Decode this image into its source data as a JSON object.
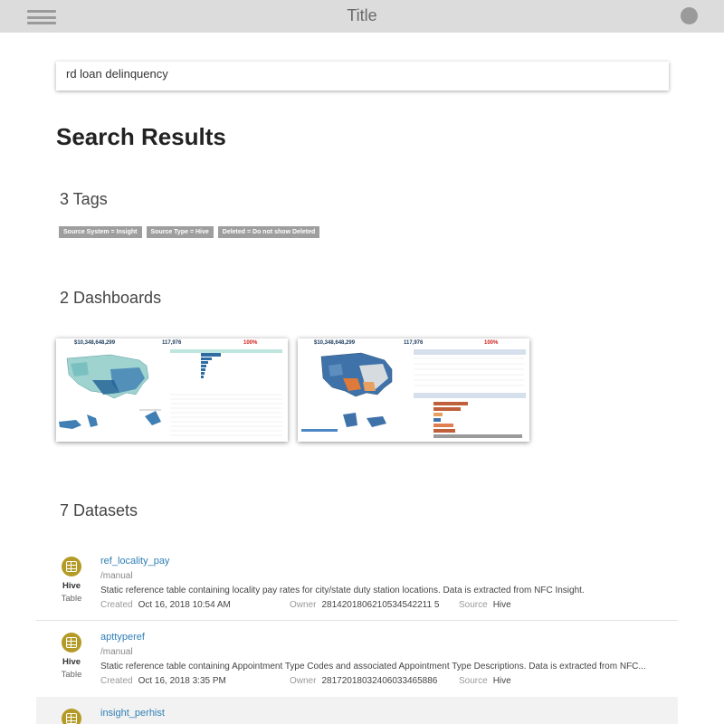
{
  "header": {
    "title": "Title",
    "menu_icon": "hamburger-menu-icon",
    "avatar_icon": "user-avatar-icon"
  },
  "search": {
    "query": "rd loan delinquency"
  },
  "results": {
    "heading": "Search Results"
  },
  "tags": {
    "heading": "3 Tags",
    "items": [
      "Source System = Insight",
      "Source Type = Hive",
      "Deleted = Do not show Deleted"
    ]
  },
  "dashboards": {
    "heading": "2 Dashboards",
    "items": [
      {
        "kpi1": "$10,348,648,299",
        "kpi2": "117,976",
        "kpi3": "100%"
      },
      {
        "kpi1": "$10,348,648,299",
        "kpi2": "117,976",
        "kpi3": "100%"
      }
    ]
  },
  "datasets": {
    "heading": "7 Datasets",
    "owner_label": "Owner",
    "created_label": "Created",
    "source_label": "Source",
    "items": [
      {
        "name": "ref_locality_pay",
        "path": "/manual",
        "description": "Static reference table containing locality pay rates for city/state duty station locations. Data is extracted from NFC Insight.",
        "created": "Oct 16, 2018 10:54 AM",
        "owner": "2814201806210534542211 5",
        "source": "Hive",
        "source_badge": "Hive",
        "type_badge": "Table"
      },
      {
        "name": "apttyperef",
        "path": "/manual",
        "description": "Static reference table containing Appointment Type Codes and associated Appointment Type Descriptions. Data is extracted from NFC...",
        "created": "Oct 16, 2018 3:35 PM",
        "owner": "28172018032406033465886",
        "source": "Hive",
        "source_badge": "Hive",
        "type_badge": "Table"
      },
      {
        "name": "insight_perhist",
        "path": "",
        "description": "",
        "created": "",
        "owner": "",
        "source": "",
        "source_badge": "",
        "type_badge": ""
      }
    ]
  },
  "colors": {
    "topbar": "#dcdcdc",
    "link": "#2f7fb5",
    "dataset_icon": "#b49a26",
    "tag": "#9e9e9e"
  }
}
